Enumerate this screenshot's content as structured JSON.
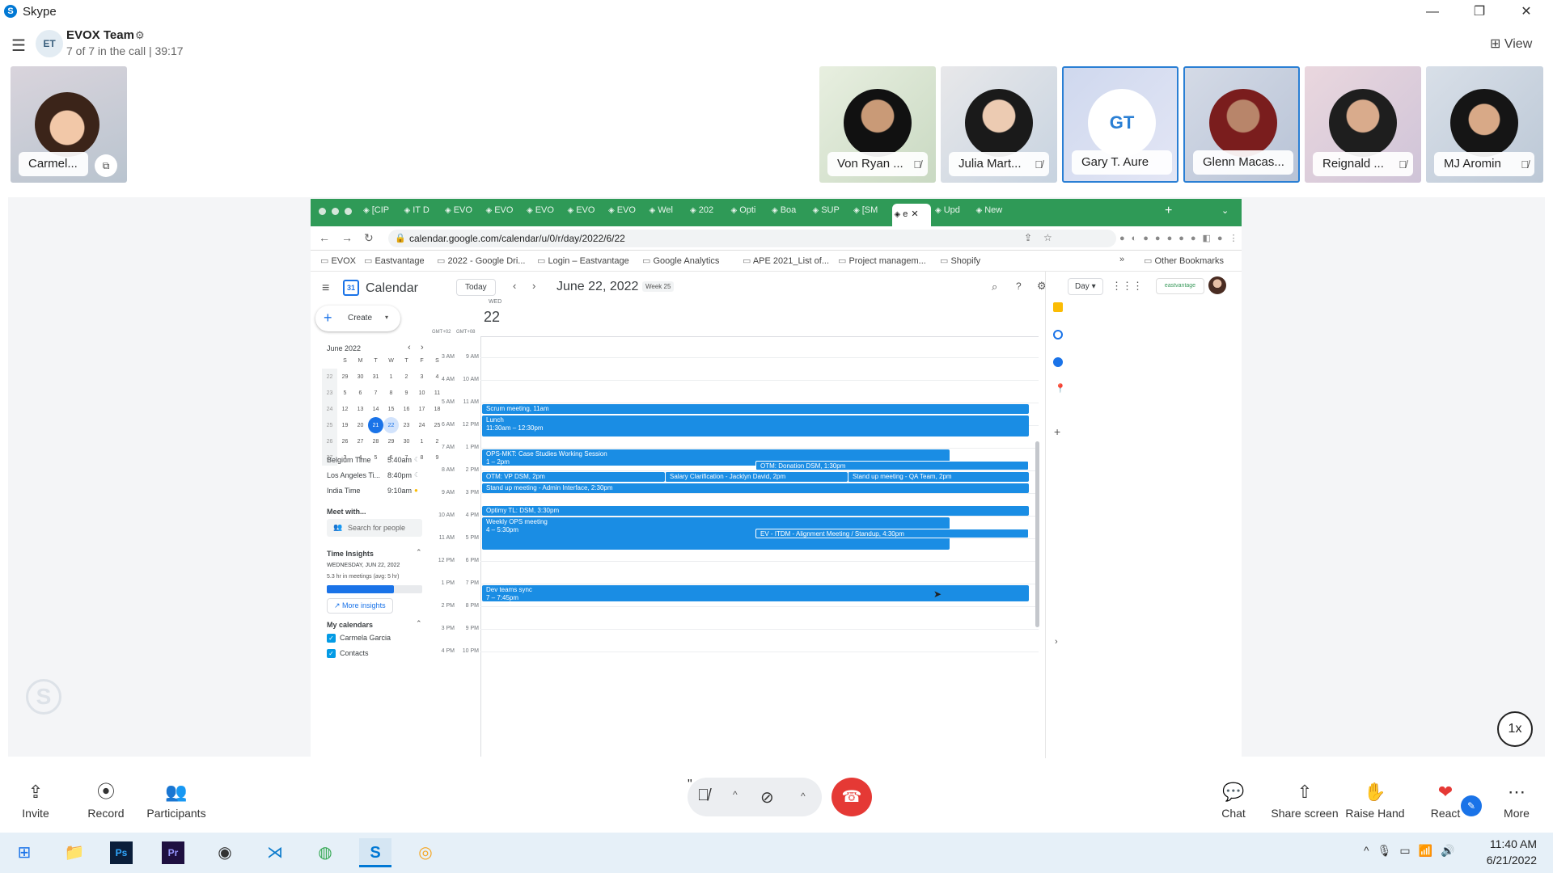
{
  "app": {
    "title": "Skype"
  },
  "call": {
    "group_name": "EVOX Team",
    "group_initials": "ET",
    "status": "7 of 7 in the call | 39:17",
    "view_label": "View",
    "self_name": "Carmel...",
    "speed": "1x"
  },
  "participants": [
    {
      "name": "Von Ryan ...",
      "muted": true
    },
    {
      "name": "Julia Mart...",
      "muted": true
    },
    {
      "name": "Gary T. Aure",
      "initials": "GT",
      "muted": false
    },
    {
      "name": "Glenn Macas...",
      "muted": false
    },
    {
      "name": "Reignald ...",
      "muted": true
    },
    {
      "name": "MJ Aromin",
      "muted": true
    }
  ],
  "browser": {
    "tabs": [
      "[CIP",
      "IT D",
      "EVO",
      "EVO",
      "EVO",
      "EVO",
      "EVO",
      "Wel",
      "202",
      "Opti",
      "Boa",
      "SUP",
      "[SM",
      "e",
      "Upd",
      "New"
    ],
    "url": "calendar.google.com/calendar/u/0/r/day/2022/6/22",
    "bookmarks": [
      "EVOX",
      "Eastvantage",
      "2022 - Google Dri...",
      "Login – Eastvantage",
      "Google Analytics",
      "APE 2021_List of...",
      "Project managem...",
      "Shopify"
    ],
    "other_bookmarks": "Other Bookmarks"
  },
  "calendar": {
    "app_name": "Calendar",
    "today": "Today",
    "date": "June 22, 2022",
    "week": "Week 25",
    "view": "Day",
    "day_label": "WED",
    "day_number": "22",
    "create": "Create",
    "tz1": "GMT+02",
    "tz2": "GMT+08",
    "month_label": "June 2022",
    "weekdays": [
      "S",
      "M",
      "T",
      "W",
      "T",
      "F",
      "S"
    ],
    "weeks": [
      [
        "22",
        "29",
        "30",
        "31",
        "1",
        "2",
        "3",
        "4"
      ],
      [
        "23",
        "5",
        "6",
        "7",
        "8",
        "9",
        "10",
        "11"
      ],
      [
        "24",
        "12",
        "13",
        "14",
        "15",
        "16",
        "17",
        "18"
      ],
      [
        "25",
        "19",
        "20",
        "21",
        "22",
        "23",
        "24",
        "25"
      ],
      [
        "26",
        "26",
        "27",
        "28",
        "29",
        "30",
        "1",
        "2"
      ],
      [
        "27",
        "3",
        "4",
        "5",
        "6",
        "7",
        "8",
        "9"
      ]
    ],
    "world_clock": [
      {
        "city": "Belgium Time",
        "time": "5:40am"
      },
      {
        "city": "Los Angeles Ti...",
        "time": "8:40pm"
      },
      {
        "city": "India Time",
        "time": "9:10am"
      }
    ],
    "meet_with": "Meet with...",
    "search_people": "Search for people",
    "time_insights": "Time Insights",
    "insights_date": "WEDNESDAY, JUN 22, 2022",
    "insights_summary": "5.3 hr in meetings (avg: 5 hr)",
    "insights_fraction": 0.7,
    "more_insights": "More insights",
    "my_calendars": "My calendars",
    "calendars": [
      "Carmela Garcia",
      "Contacts"
    ],
    "hours": [
      {
        "l": "3 AM",
        "r": "9 AM"
      },
      {
        "l": "4 AM",
        "r": "10 AM"
      },
      {
        "l": "5 AM",
        "r": "11 AM"
      },
      {
        "l": "6 AM",
        "r": "12 PM"
      },
      {
        "l": "7 AM",
        "r": "1 PM"
      },
      {
        "l": "8 AM",
        "r": "2 PM"
      },
      {
        "l": "9 AM",
        "r": "3 PM"
      },
      {
        "l": "10 AM",
        "r": "4 PM"
      },
      {
        "l": "11 AM",
        "r": "5 PM"
      },
      {
        "l": "12 PM",
        "r": "6 PM"
      },
      {
        "l": "1 PM",
        "r": "7 PM"
      },
      {
        "l": "2 PM",
        "r": "8 PM"
      },
      {
        "l": "3 PM",
        "r": "9 PM"
      },
      {
        "l": "4 PM",
        "r": "10 PM"
      }
    ],
    "events": {
      "scrum": "Scrum meeting, 11am",
      "lunch_title": "Lunch",
      "lunch_time": "11:30am – 12:30pm",
      "ops_title": "OPS-MKT: Case Studies Working Session",
      "ops_time": "1 – 2pm",
      "donation": "OTM: Donation DSM, 1:30pm",
      "vp": "OTM: VP DSM, 2pm",
      "salary": "Salary Clarification - Jacklyn David, 2pm",
      "qa": "Stand up meeting - QA Team, 2pm",
      "admin": "Stand up meeting - Admin Interface, 2:30pm",
      "optimy": "Optimy TL: DSM, 3:30pm",
      "weekly_title": "Weekly OPS meeting",
      "weekly_time": "4 – 5:30pm",
      "itdm": "EV - ITDM - Alignment Meeting / Standup, 4:30pm",
      "dev_title": "Dev teams sync",
      "dev_time": "7 – 7:45pm"
    }
  },
  "controls": {
    "invite": "Invite",
    "record": "Record",
    "participants": "Participants",
    "chat": "Chat",
    "share": "Share screen",
    "raise": "Raise Hand",
    "react": "React",
    "more": "More"
  },
  "taskbar": {
    "time": "11:40 AM",
    "date": "6/21/2022"
  },
  "colors": {
    "brand": "#0078d4",
    "hangup": "#e53935",
    "event": "#1a8de4",
    "chrome_tab": "#2f9a57"
  }
}
